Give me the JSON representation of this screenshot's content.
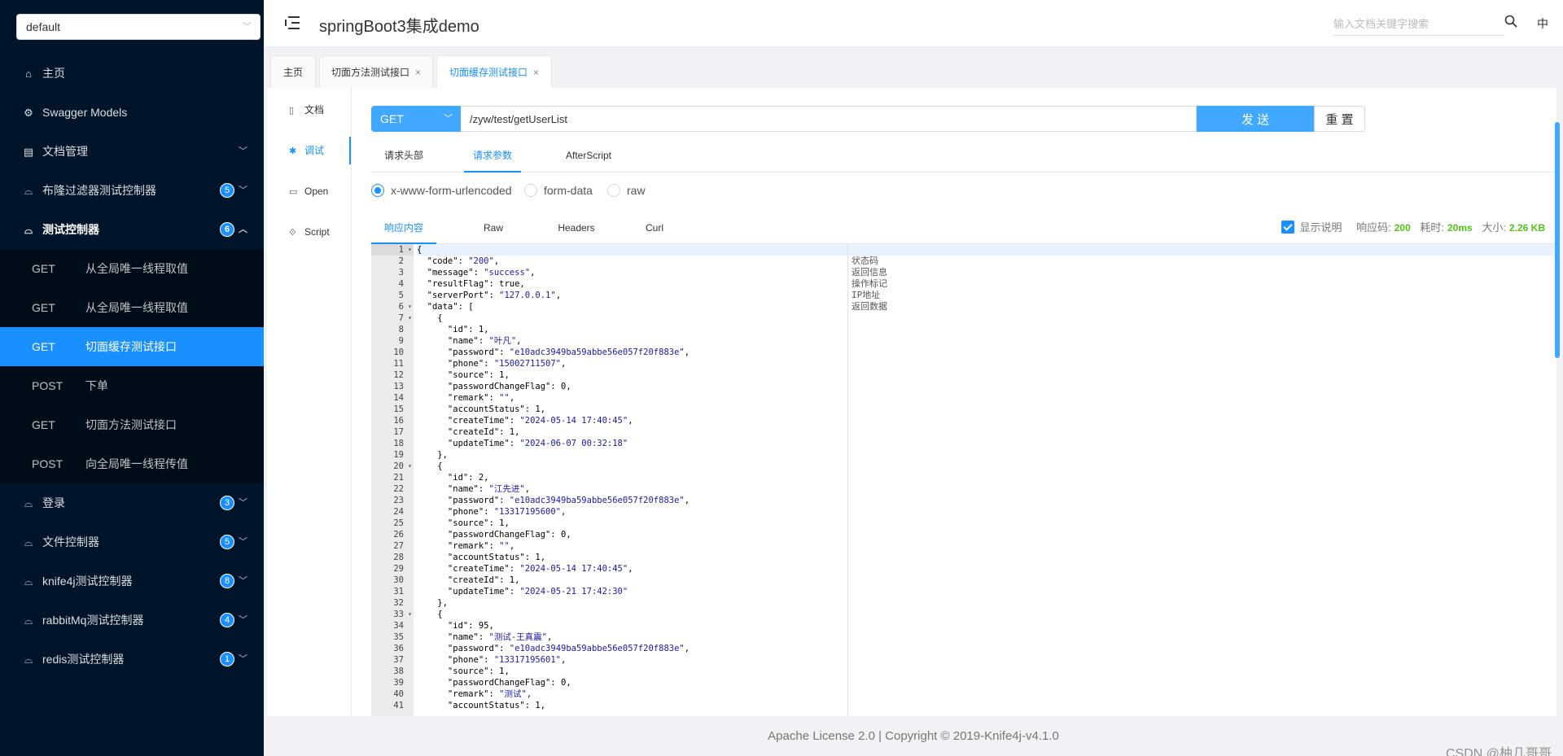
{
  "sidebar": {
    "group_select": "default",
    "menu": [
      {
        "label": "主页",
        "icon": "home-icon",
        "glyph": "⌂"
      },
      {
        "label": "Swagger Models",
        "icon": "appstore-icon",
        "glyph": "⚙"
      },
      {
        "label": "文档管理",
        "icon": "doc-manage-icon",
        "glyph": "▤",
        "arrow": true
      }
    ],
    "groups": [
      {
        "label": "布隆过滤器测试控制器",
        "badge": "5"
      },
      {
        "label": "测试控制器",
        "badge": "6"
      }
    ],
    "sub_items": [
      {
        "method": "GET",
        "label": "从全局唯一线程取值"
      },
      {
        "method": "GET",
        "label": "从全局唯一线程取值"
      },
      {
        "method": "GET",
        "label": "切面缓存测试接口"
      },
      {
        "method": "POST",
        "label": "下单"
      },
      {
        "method": "GET",
        "label": "切面方法测试接口"
      },
      {
        "method": "POST",
        "label": "向全局唯一线程传值"
      }
    ],
    "groups2": [
      {
        "label": "登录",
        "badge": "3"
      },
      {
        "label": "文件控制器",
        "badge": "5"
      },
      {
        "label": "knife4j测试控制器",
        "badge": "8"
      },
      {
        "label": "rabbitMq测试控制器",
        "badge": "4"
      },
      {
        "label": "redis测试控制器",
        "badge": "1"
      }
    ]
  },
  "header": {
    "title": "springBoot3集成demo",
    "search_placeholder": "输入文档关键字搜索",
    "lang": "中"
  },
  "tabs": [
    {
      "label": "主页"
    },
    {
      "label": "切面方法测试接口",
      "close": "×"
    },
    {
      "label": "切面缓存测试接口",
      "close": "×"
    }
  ],
  "vnav": [
    "文档",
    "调试",
    "Open",
    "Script"
  ],
  "request": {
    "method": "GET",
    "url": "/zyw/test/getUserList",
    "send_label": "发 送",
    "reset_label": "重 置"
  },
  "param_tabs": [
    "请求头部",
    "请求参数",
    "AfterScript"
  ],
  "content_types": [
    "x-www-form-urlencoded",
    "form-data",
    "raw"
  ],
  "response_tabs": [
    "响应内容",
    "Raw",
    "Headers",
    "Curl"
  ],
  "response_meta": {
    "show_desc": "显示说明",
    "code_label": "响应码:",
    "code": "200",
    "time_label": "耗时:",
    "time": "20ms",
    "size_label": "大小:",
    "size": "2.26 KB"
  },
  "code_lines": [
    "{",
    "  \"code\": \"200\",",
    "  \"message\": \"success\",",
    "  \"resultFlag\": true,",
    "  \"serverPort\": \"127.0.0.1\",",
    "  \"data\": [",
    "    {",
    "      \"id\": 1,",
    "      \"name\": \"叶凡\",",
    "      \"password\": \"e10adc3949ba59abbe56e057f20f883e\",",
    "      \"phone\": \"15002711507\",",
    "      \"source\": 1,",
    "      \"passwordChangeFlag\": 0,",
    "      \"remark\": \"\",",
    "      \"accountStatus\": 1,",
    "      \"createTime\": \"2024-05-14 17:40:45\",",
    "      \"createId\": 1,",
    "      \"updateTime\": \"2024-06-07 00:32:18\"",
    "    },",
    "    {",
    "      \"id\": 2,",
    "      \"name\": \"江先进\",",
    "      \"password\": \"e10adc3949ba59abbe56e057f20f883e\",",
    "      \"phone\": \"13317195600\",",
    "      \"source\": 1,",
    "      \"passwordChangeFlag\": 0,",
    "      \"remark\": \"\",",
    "      \"accountStatus\": 1,",
    "      \"createTime\": \"2024-05-14 17:40:45\",",
    "      \"createId\": 1,",
    "      \"updateTime\": \"2024-05-21 17:42:30\"",
    "    },",
    "    {",
    "      \"id\": 95,",
    "      \"name\": \"测试-王真震\",",
    "      \"password\": \"e10adc3949ba59abbe56e057f20f883e\",",
    "      \"phone\": \"13317195601\",",
    "      \"source\": 1,",
    "      \"passwordChangeFlag\": 0,",
    "      \"remark\": \"测试\",",
    "      \"accountStatus\": 1,"
  ],
  "fold_lines": [
    1,
    6,
    7,
    20,
    33
  ],
  "comments": [
    "状态码",
    "返回信息",
    "操作标记",
    "IP地址",
    "返回数据"
  ],
  "footer": "Apache License 2.0 | Copyright © 2019-Knife4j-v4.1.0",
  "watermark": "CSDN @柚几哥哥",
  "colors": {
    "accent": "#1890ff",
    "sidebar_bg": "#001529",
    "send_btn": "#40a9ff",
    "success": "#52c41a"
  }
}
